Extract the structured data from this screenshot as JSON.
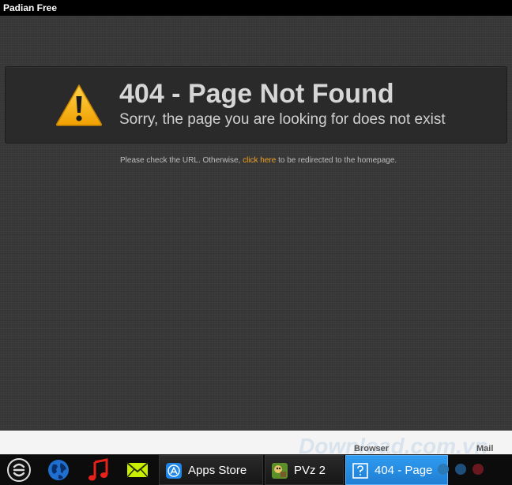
{
  "window": {
    "title": "Padian Free"
  },
  "error": {
    "title": "404 - Page Not Found",
    "subtitle": "Sorry, the page you are looking for does not exist",
    "hint_prefix": "Please check the URL. Otherwise, ",
    "hint_link": "click here",
    "hint_suffix": " to be redirected to the homepage."
  },
  "bottom_strip": {
    "left_label": "Browser",
    "right_label": "Mail",
    "watermark": "Download.com.vn"
  },
  "taskbar": {
    "launchers": [
      {
        "icon": "padian-logo-icon"
      },
      {
        "icon": "globe-icon"
      },
      {
        "icon": "music-note-icon"
      },
      {
        "icon": "mail-icon"
      }
    ],
    "tasks": [
      {
        "label": "Apps Store",
        "icon": "app-store-icon"
      },
      {
        "label": "PVz 2",
        "icon": "pvz-game-icon"
      },
      {
        "label": "404 - Page",
        "icon": "unknown-page-icon",
        "active": true
      }
    ]
  },
  "colors": {
    "accent_link": "#f0a020",
    "active_task": "#2f9bf0",
    "warning_icon": "#f5b800"
  }
}
